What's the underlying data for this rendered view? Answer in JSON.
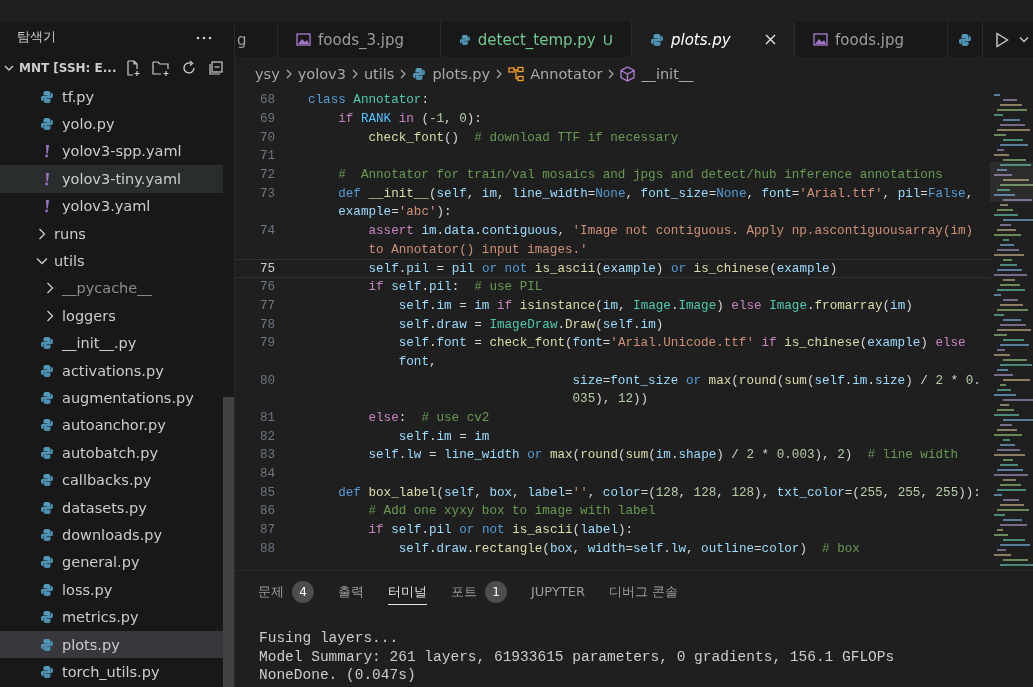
{
  "explorer": {
    "title": "탐색기",
    "root": "MNT [SSH: E...",
    "tree": [
      {
        "kind": "continued",
        "children": [
          {
            "label": "tf.py",
            "kind": "python",
            "selected": false,
            "hovered": false,
            "dimmed": false
          },
          {
            "label": "yolo.py",
            "kind": "python",
            "selected": false,
            "hovered": false,
            "dimmed": false
          },
          {
            "label": "yolov3-spp.yaml",
            "kind": "yaml",
            "selected": false,
            "hovered": false,
            "dimmed": false
          },
          {
            "label": "yolov3-tiny.yaml",
            "kind": "yaml",
            "selected": false,
            "hovered": true,
            "dimmed": false
          },
          {
            "label": "yolov3.yaml",
            "kind": "yaml",
            "selected": false,
            "hovered": false,
            "dimmed": false
          }
        ]
      },
      {
        "label": "runs",
        "kind": "folder",
        "expanded": false,
        "selected": false,
        "hovered": false,
        "dimmed": false
      },
      {
        "label": "utils",
        "kind": "folder",
        "expanded": true,
        "selected": false,
        "hovered": false,
        "dimmed": false,
        "children": [
          {
            "label": "__pycache__",
            "kind": "folder",
            "expanded": false,
            "selected": false,
            "hovered": false,
            "dimmed": true
          },
          {
            "label": "loggers",
            "kind": "folder",
            "expanded": false,
            "selected": false,
            "hovered": false,
            "dimmed": false
          },
          {
            "label": "__init__.py",
            "kind": "python",
            "selected": false,
            "hovered": false,
            "dimmed": false
          },
          {
            "label": "activations.py",
            "kind": "python",
            "selected": false,
            "hovered": false,
            "dimmed": false
          },
          {
            "label": "augmentations.py",
            "kind": "python",
            "selected": false,
            "hovered": false,
            "dimmed": false
          },
          {
            "label": "autoanchor.py",
            "kind": "python",
            "selected": false,
            "hovered": false,
            "dimmed": false
          },
          {
            "label": "autobatch.py",
            "kind": "python",
            "selected": false,
            "hovered": false,
            "dimmed": false
          },
          {
            "label": "callbacks.py",
            "kind": "python",
            "selected": false,
            "hovered": false,
            "dimmed": false
          },
          {
            "label": "datasets.py",
            "kind": "python",
            "selected": false,
            "hovered": false,
            "dimmed": false
          },
          {
            "label": "downloads.py",
            "kind": "python",
            "selected": false,
            "hovered": false,
            "dimmed": false
          },
          {
            "label": "general.py",
            "kind": "python",
            "selected": false,
            "hovered": false,
            "dimmed": false
          },
          {
            "label": "loss.py",
            "kind": "python",
            "selected": false,
            "hovered": false,
            "dimmed": false
          },
          {
            "label": "metrics.py",
            "kind": "python",
            "selected": false,
            "hovered": false,
            "dimmed": false
          },
          {
            "label": "plots.py",
            "kind": "python",
            "selected": true,
            "hovered": false,
            "dimmed": false
          },
          {
            "label": "torch_utils.py",
            "kind": "python",
            "selected": false,
            "hovered": false,
            "dimmed": false
          }
        ]
      }
    ]
  },
  "tabs": [
    {
      "label": "g",
      "selected": false
    },
    {
      "label": "foods_3.jpg",
      "kind": "image",
      "selected": false
    },
    {
      "label": "detect_temp.py",
      "kind": "python",
      "selected": false,
      "badge": "U"
    },
    {
      "label": "plots.py",
      "kind": "python",
      "selected": true
    },
    {
      "label": "foods.jpg",
      "kind": "image",
      "selected": false
    },
    {
      "kind": "python",
      "selected": false
    }
  ],
  "breadcrumb": [
    {
      "label": "ysy",
      "kind": "folder"
    },
    {
      "label": "yolov3",
      "kind": "folder"
    },
    {
      "label": "utils",
      "kind": "folder"
    },
    {
      "label": "plots.py",
      "kind": "python"
    },
    {
      "label": "Annotator",
      "kind": "class"
    },
    {
      "label": "__init__",
      "kind": "method"
    }
  ],
  "code": [
    {
      "number": "68",
      "current": false,
      "rows": [
        [
          {
            "kind": "kw",
            "text": "class "
          },
          {
            "kind": "cls",
            "text": "Annotator"
          },
          ":"
        ]
      ]
    },
    {
      "number": "69",
      "current": false,
      "rows": [
        [
          "    ",
          {
            "kind": "ctl",
            "text": "if "
          },
          {
            "kind": "const",
            "text": "RANK "
          },
          {
            "kind": "ctl",
            "text": "in "
          },
          "(",
          {
            "kind": "num",
            "text": "-1"
          },
          ", ",
          {
            "kind": "num",
            "text": "0"
          },
          "):"
        ]
      ]
    },
    {
      "number": "70",
      "current": false,
      "rows": [
        [
          "        ",
          {
            "kind": "fn",
            "text": "check_font"
          },
          "()  ",
          {
            "kind": "cmt",
            "text": "# download TTF if necessary"
          }
        ]
      ]
    },
    {
      "number": "71",
      "current": false
    },
    {
      "number": "72",
      "current": false,
      "rows": [
        [
          "    ",
          {
            "kind": "cmt",
            "text": "#  Annotator for train/val mosaics and jpgs and detect/hub inference annotations"
          }
        ]
      ]
    },
    {
      "number": "73",
      "current": false,
      "rows": [
        [
          "    ",
          {
            "kind": "kw",
            "text": "def "
          },
          {
            "kind": "fn",
            "text": "__init__"
          },
          "(",
          {
            "kind": "var",
            "text": "self"
          },
          ", ",
          {
            "kind": "var",
            "text": "im"
          },
          ", ",
          {
            "kind": "var",
            "text": "line_width"
          },
          "=",
          {
            "kind": "kw",
            "text": "None"
          },
          ", ",
          {
            "kind": "var",
            "text": "font_size"
          },
          "=",
          {
            "kind": "kw",
            "text": "None"
          },
          ", ",
          {
            "kind": "var",
            "text": "font"
          },
          "=",
          {
            "kind": "str",
            "text": "'Arial.ttf'"
          },
          ", ",
          {
            "kind": "var",
            "text": "pil"
          },
          "=",
          {
            "kind": "kw",
            "text": "False"
          },
          ","
        ],
        [
          "    ",
          {
            "kind": "var",
            "text": "example"
          },
          "=",
          {
            "kind": "str",
            "text": "'abc'"
          },
          "):"
        ]
      ]
    },
    {
      "number": "74",
      "current": false,
      "rows": [
        [
          "        ",
          {
            "kind": "ctl",
            "text": "assert "
          },
          {
            "kind": "var",
            "text": "im"
          },
          ".",
          {
            "kind": "var",
            "text": "data"
          },
          ".",
          {
            "kind": "var",
            "text": "contiguous"
          },
          ", ",
          {
            "kind": "str",
            "text": "'Image not contiguous. Apply np.ascontiguousarray(im)"
          }
        ],
        [
          "        ",
          {
            "kind": "str",
            "text": "to Annotator() input images.'"
          }
        ]
      ]
    },
    {
      "number": "75",
      "current": true,
      "rows": [
        [
          "        ",
          {
            "kind": "var",
            "text": "self"
          },
          ".",
          {
            "kind": "var",
            "text": "pil"
          },
          " = ",
          {
            "kind": "var",
            "text": "pil"
          },
          " ",
          {
            "kind": "kw",
            "text": "or"
          },
          " ",
          {
            "kind": "kw",
            "text": "not"
          },
          " ",
          {
            "kind": "fn",
            "text": "is_ascii"
          },
          "(",
          {
            "kind": "var",
            "text": "example"
          },
          ") ",
          {
            "kind": "kw",
            "text": "or"
          },
          " ",
          {
            "kind": "fn",
            "text": "is_chinese"
          },
          "(",
          {
            "kind": "var",
            "text": "example"
          },
          ")"
        ]
      ]
    },
    {
      "number": "76",
      "current": false,
      "rows": [
        [
          "        ",
          {
            "kind": "ctl",
            "text": "if "
          },
          {
            "kind": "var",
            "text": "self"
          },
          ".",
          {
            "kind": "var",
            "text": "pil"
          },
          ":  ",
          {
            "kind": "cmt",
            "text": "# use PIL"
          }
        ]
      ]
    },
    {
      "number": "77",
      "current": false,
      "rows": [
        [
          "            ",
          {
            "kind": "var",
            "text": "self"
          },
          ".",
          {
            "kind": "var",
            "text": "im"
          },
          " = ",
          {
            "kind": "var",
            "text": "im"
          },
          " ",
          {
            "kind": "ctl",
            "text": "if"
          },
          " ",
          {
            "kind": "fn",
            "text": "isinstance"
          },
          "(",
          {
            "kind": "var",
            "text": "im"
          },
          ", ",
          {
            "kind": "cls",
            "text": "Image"
          },
          ".",
          {
            "kind": "cls",
            "text": "Image"
          },
          ") ",
          {
            "kind": "ctl",
            "text": "else"
          },
          " ",
          {
            "kind": "cls",
            "text": "Image"
          },
          ".",
          {
            "kind": "fn",
            "text": "fromarray"
          },
          "(",
          {
            "kind": "var",
            "text": "im"
          },
          ")"
        ]
      ]
    },
    {
      "number": "78",
      "current": false,
      "rows": [
        [
          "            ",
          {
            "kind": "var",
            "text": "self"
          },
          ".",
          {
            "kind": "var",
            "text": "draw"
          },
          " = ",
          {
            "kind": "cls",
            "text": "ImageDraw"
          },
          ".",
          {
            "kind": "fn",
            "text": "Draw"
          },
          "(",
          {
            "kind": "var",
            "text": "self"
          },
          ".",
          {
            "kind": "var",
            "text": "im"
          },
          ")"
        ]
      ]
    },
    {
      "number": "79",
      "current": false,
      "rows": [
        [
          "            ",
          {
            "kind": "var",
            "text": "self"
          },
          ".",
          {
            "kind": "var",
            "text": "font"
          },
          " = ",
          {
            "kind": "fn",
            "text": "check_font"
          },
          "(",
          {
            "kind": "var",
            "text": "font"
          },
          "=",
          {
            "kind": "str",
            "text": "'Arial.Unicode.ttf'"
          },
          " ",
          {
            "kind": "ctl",
            "text": "if"
          },
          " ",
          {
            "kind": "fn",
            "text": "is_chinese"
          },
          "(",
          {
            "kind": "var",
            "text": "example"
          },
          ") ",
          {
            "kind": "ctl",
            "text": "else"
          }
        ],
        [
          "            ",
          {
            "kind": "var",
            "text": "font"
          },
          ","
        ]
      ]
    },
    {
      "number": "80",
      "current": false,
      "rows": [
        [
          "                                   ",
          {
            "kind": "var",
            "text": "size"
          },
          "=",
          {
            "kind": "var",
            "text": "font_size"
          },
          " ",
          {
            "kind": "kw",
            "text": "or"
          },
          " ",
          {
            "kind": "fn",
            "text": "max"
          },
          "(",
          {
            "kind": "fn",
            "text": "round"
          },
          "(",
          {
            "kind": "fn",
            "text": "sum"
          },
          "(",
          {
            "kind": "var",
            "text": "self"
          },
          ".",
          {
            "kind": "var",
            "text": "im"
          },
          ".",
          {
            "kind": "var",
            "text": "size"
          },
          ") / ",
          {
            "kind": "num",
            "text": "2"
          },
          " * ",
          {
            "kind": "num",
            "text": "0."
          }
        ],
        [
          "                                   ",
          {
            "kind": "num",
            "text": "035"
          },
          "), ",
          {
            "kind": "num",
            "text": "12"
          },
          "))"
        ]
      ]
    },
    {
      "number": "81",
      "current": false,
      "rows": [
        [
          "        ",
          {
            "kind": "ctl",
            "text": "else"
          },
          ":  ",
          {
            "kind": "cmt",
            "text": "# use cv2"
          }
        ]
      ]
    },
    {
      "number": "82",
      "current": false,
      "rows": [
        [
          "            ",
          {
            "kind": "var",
            "text": "self"
          },
          ".",
          {
            "kind": "var",
            "text": "im"
          },
          " = ",
          {
            "kind": "var",
            "text": "im"
          }
        ]
      ]
    },
    {
      "number": "83",
      "current": false,
      "rows": [
        [
          "        ",
          {
            "kind": "var",
            "text": "self"
          },
          ".",
          {
            "kind": "var",
            "text": "lw"
          },
          " = ",
          {
            "kind": "var",
            "text": "line_width"
          },
          " ",
          {
            "kind": "kw",
            "text": "or"
          },
          " ",
          {
            "kind": "fn",
            "text": "max"
          },
          "(",
          {
            "kind": "fn",
            "text": "round"
          },
          "(",
          {
            "kind": "fn",
            "text": "sum"
          },
          "(",
          {
            "kind": "var",
            "text": "im"
          },
          ".",
          {
            "kind": "var",
            "text": "shape"
          },
          ") / ",
          {
            "kind": "num",
            "text": "2"
          },
          " * ",
          {
            "kind": "num",
            "text": "0.003"
          },
          "), ",
          {
            "kind": "num",
            "text": "2"
          },
          ")  ",
          {
            "kind": "cmt",
            "text": "# line width"
          }
        ]
      ]
    },
    {
      "number": "84",
      "current": false
    },
    {
      "number": "85",
      "current": false,
      "rows": [
        [
          "    ",
          {
            "kind": "kw",
            "text": "def "
          },
          {
            "kind": "fn",
            "text": "box_label"
          },
          "(",
          {
            "kind": "var",
            "text": "self"
          },
          ", ",
          {
            "kind": "var",
            "text": "box"
          },
          ", ",
          {
            "kind": "var",
            "text": "label"
          },
          "=",
          {
            "kind": "str",
            "text": "''"
          },
          ", ",
          {
            "kind": "var",
            "text": "color"
          },
          "=(",
          {
            "kind": "num",
            "text": "128"
          },
          ", ",
          {
            "kind": "num",
            "text": "128"
          },
          ", ",
          {
            "kind": "num",
            "text": "128"
          },
          "), ",
          {
            "kind": "var",
            "text": "txt_color"
          },
          "=(",
          {
            "kind": "num",
            "text": "255"
          },
          ", ",
          {
            "kind": "num",
            "text": "255"
          },
          ", ",
          {
            "kind": "num",
            "text": "255"
          },
          ")):"
        ]
      ]
    },
    {
      "number": "86",
      "current": false,
      "rows": [
        [
          "        ",
          {
            "kind": "cmt",
            "text": "# Add one xyxy box to image with label"
          }
        ]
      ]
    },
    {
      "number": "87",
      "current": false,
      "rows": [
        [
          "        ",
          {
            "kind": "ctl",
            "text": "if "
          },
          {
            "kind": "var",
            "text": "self"
          },
          ".",
          {
            "kind": "var",
            "text": "pil"
          },
          " ",
          {
            "kind": "kw",
            "text": "or"
          },
          " ",
          {
            "kind": "kw",
            "text": "not"
          },
          " ",
          {
            "kind": "fn",
            "text": "is_ascii"
          },
          "(",
          {
            "kind": "var",
            "text": "label"
          },
          "):"
        ]
      ]
    },
    {
      "number": "88",
      "current": false,
      "rows": [
        [
          "            ",
          {
            "kind": "var",
            "text": "self"
          },
          ".",
          {
            "kind": "var",
            "text": "draw"
          },
          ".",
          {
            "kind": "fn",
            "text": "rectangle"
          },
          "(",
          {
            "kind": "var",
            "text": "box"
          },
          ", ",
          {
            "kind": "var",
            "text": "width"
          },
          "=",
          {
            "kind": "var",
            "text": "self"
          },
          ".",
          {
            "kind": "var",
            "text": "lw"
          },
          ", ",
          {
            "kind": "var",
            "text": "outline"
          },
          "=",
          {
            "kind": "var",
            "text": "color"
          },
          ")  ",
          {
            "kind": "cmt",
            "text": "# box"
          }
        ]
      ]
    }
  ],
  "panel": {
    "tabs": [
      {
        "label": "문제",
        "selected": false,
        "badge": "4"
      },
      {
        "label": "출력",
        "selected": false
      },
      {
        "label": "터미널",
        "selected": true
      },
      {
        "label": "포트",
        "selected": false,
        "badge": "1"
      },
      {
        "label": "JUPYTER",
        "selected": false
      },
      {
        "label": "디버그 콘솔",
        "selected": false
      }
    ],
    "terminal": [
      "Fusing layers...",
      "Model Summary: 261 layers, 61933615 parameters, 0 gradients, 156.1 GFLOPs",
      "NoneDone. (0.047s)"
    ]
  }
}
